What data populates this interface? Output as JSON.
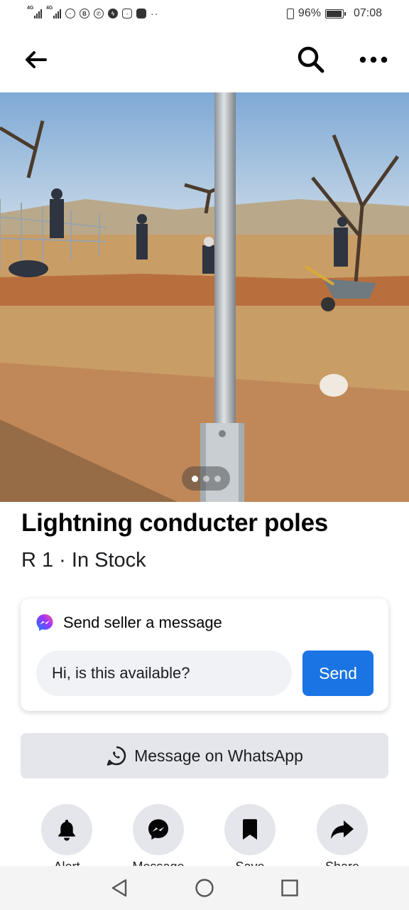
{
  "status_bar": {
    "network_1": "4G",
    "network_2": "4G",
    "nfc_badge": "B",
    "battery": "96%",
    "battery_level": 0.96,
    "time": "07:08"
  },
  "listing": {
    "title": "Lightning conducter poles",
    "price_stock": "R 1 · In Stock",
    "photo_count": 3,
    "current_photo": 1
  },
  "message_card": {
    "heading": "Send seller a message",
    "input_value": "Hi, is this available?",
    "send_label": "Send"
  },
  "whatsapp": {
    "label": "Message on WhatsApp"
  },
  "actions": [
    {
      "label": "Alert",
      "icon": "bell-icon"
    },
    {
      "label": "Message",
      "icon": "messenger-icon"
    },
    {
      "label": "Save",
      "icon": "bookmark-icon"
    },
    {
      "label": "Share",
      "icon": "share-icon"
    }
  ],
  "colors": {
    "accent": "#1b74e4",
    "button_bg": "#e4e6eb",
    "input_bg": "#f0f2f5"
  }
}
